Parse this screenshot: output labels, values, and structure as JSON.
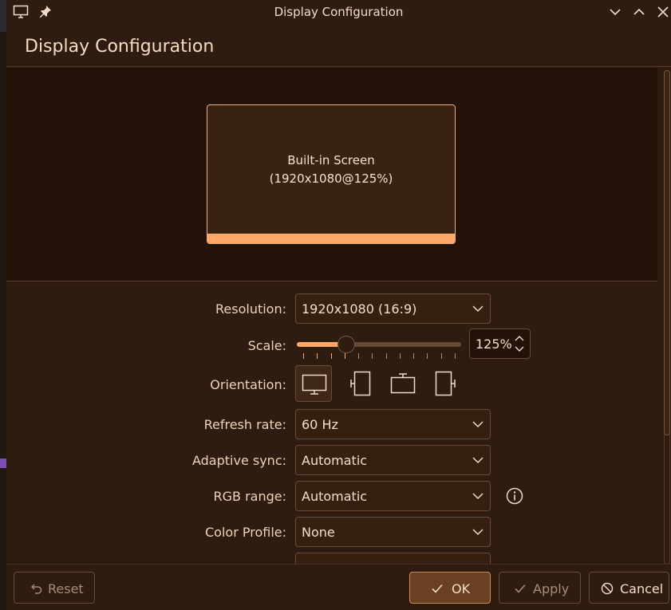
{
  "window": {
    "title": "Display Configuration",
    "icons": [
      "monitor-icon",
      "pin-icon"
    ],
    "controls": [
      "minimize-icon",
      "maximize-icon",
      "close-icon"
    ]
  },
  "header": {
    "title": "Display Configuration"
  },
  "preview": {
    "screen_name": "Built-in Screen",
    "screen_mode": "(1920x1080@125%)"
  },
  "form": {
    "resolution": {
      "label": "Resolution:",
      "value": "1920x1080 (16:9)"
    },
    "scale": {
      "label": "Scale:",
      "value": "125%",
      "level": 0.3
    },
    "orientation": {
      "label": "Orientation:",
      "options": [
        "landscape",
        "portrait-left",
        "landscape-flipped",
        "portrait-right"
      ],
      "selected": "landscape"
    },
    "refresh_rate": {
      "label": "Refresh rate:",
      "value": "60 Hz"
    },
    "adaptive_sync": {
      "label": "Adaptive sync:",
      "value": "Automatic"
    },
    "rgb_range": {
      "label": "RGB range:",
      "value": "Automatic",
      "info_icon": "info-icon"
    },
    "color_profile": {
      "label": "Color Profile:",
      "value": "None"
    }
  },
  "footer": {
    "reset": "Reset",
    "ok": "OK",
    "apply": "Apply",
    "cancel": "Cancel"
  },
  "colors": {
    "accent": "#ffa868",
    "background": "#2e1c10",
    "preview_background": "#221208"
  }
}
